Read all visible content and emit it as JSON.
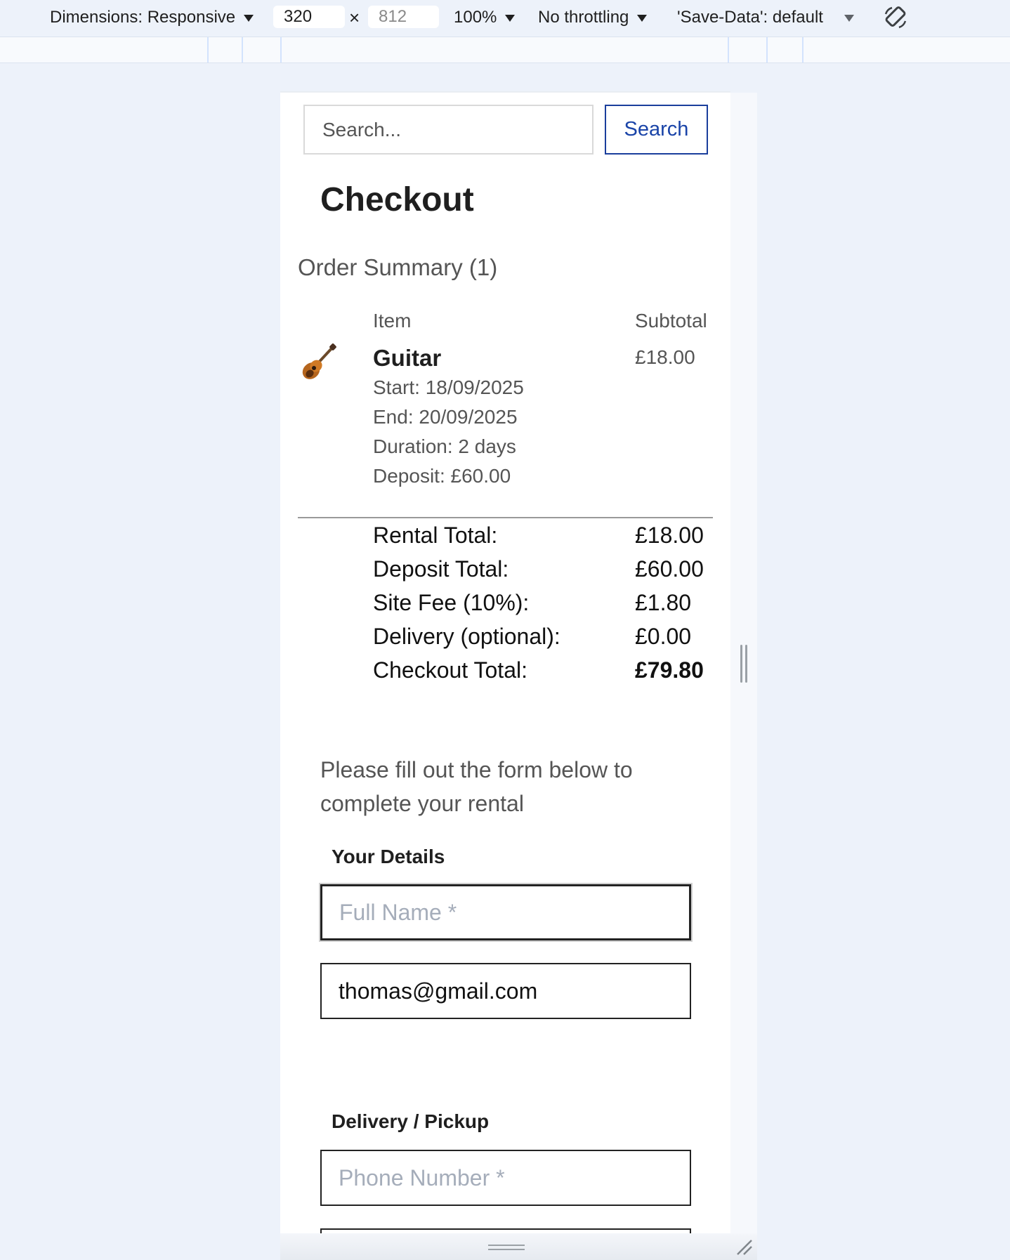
{
  "devtools": {
    "dimensions_label": "Dimensions: Responsive",
    "width_value": "320",
    "times_sign": "×",
    "height_value": "812",
    "zoom_label": "100%",
    "throttling_label": "No throttling",
    "save_data_label": "'Save-Data': default"
  },
  "header": {
    "search_placeholder": "Search...",
    "search_button_label": "Search"
  },
  "page": {
    "title": "Checkout"
  },
  "order_summary": {
    "title": "Order Summary (1)",
    "columns": {
      "item": "Item",
      "subtotal": "Subtotal"
    },
    "items": [
      {
        "icon": "guitar-icon",
        "name": "Guitar",
        "price": "£18.00",
        "start": "Start: 18/09/2025",
        "end": "End: 20/09/2025",
        "duration": "Duration: 2 days",
        "deposit": "Deposit: £60.00"
      }
    ],
    "totals": [
      {
        "label": "Rental Total:",
        "value": "£18.00"
      },
      {
        "label": "Deposit Total:",
        "value": "£60.00"
      },
      {
        "label": "Site Fee (10%):",
        "value": "£1.80"
      },
      {
        "label": "Delivery (optional):",
        "value": "£0.00"
      },
      {
        "label": "Checkout Total:",
        "value": "£79.80"
      }
    ]
  },
  "form": {
    "intro": "Please fill out the form below to complete your rental",
    "your_details_label": "Your Details",
    "full_name_placeholder": "Full Name *",
    "email_value": "thomas@gmail.com",
    "delivery_label": "Delivery / Pickup",
    "phone_placeholder": "Phone Number *"
  }
}
